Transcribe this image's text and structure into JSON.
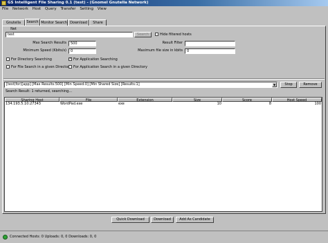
{
  "window": {
    "title": "GS Intelligent File Sharing 0.1 (test) - (Gnomel Gnutella Network)"
  },
  "menu": [
    "File",
    "Network",
    "Host",
    "Query",
    "Transfer",
    "Setting",
    "View"
  ],
  "tabs": [
    "Gnutella Net",
    "Search",
    "Monitor Search",
    "Download",
    "Share"
  ],
  "search": {
    "query_value": "test",
    "search_button": "Search",
    "hide_filtered_label": "Hide filtered hosts",
    "max_results_label": "Max Search Results",
    "max_results_value": "500",
    "min_speed_label": "Minimum Speed (Kbits/s)",
    "min_speed_value": "0",
    "result_filter_label": "Result Filter",
    "result_filter_value": "",
    "max_file_size_label": "Maximum file size in kbits",
    "max_file_size_value": "0",
    "for_directory_label": "For Directory Searching",
    "for_application_label": "For Application Searching",
    "for_application_checked": "✓",
    "for_file_dir_label": "For File Search in a given Directory",
    "for_app_dir_label": "For Application Search in a given Directory"
  },
  "results": {
    "selector_value": "[test(for)[app]   [Max Results:500]   [Min Speed:0]   [Min Shared Size]   [Results:1]",
    "stop_button": "Stop",
    "remove_button": "Remove",
    "summary": "Search Result:  1 returned, searching...",
    "columns": [
      "Sharing Host",
      "File",
      "Extension",
      "Size",
      "Score",
      "Host Speed"
    ],
    "rows": [
      [
        "134.193.5.10:27343",
        "WordPad.exe",
        "exe",
        "10",
        "8",
        "100"
      ]
    ]
  },
  "actions": {
    "quick_download": "Quick Download",
    "download": "Download",
    "add_candidate": "Add As Candidate"
  },
  "status": {
    "text": "Connected Hosts: 0    Uploads: 0, 0    Downloads: 0, 0"
  }
}
